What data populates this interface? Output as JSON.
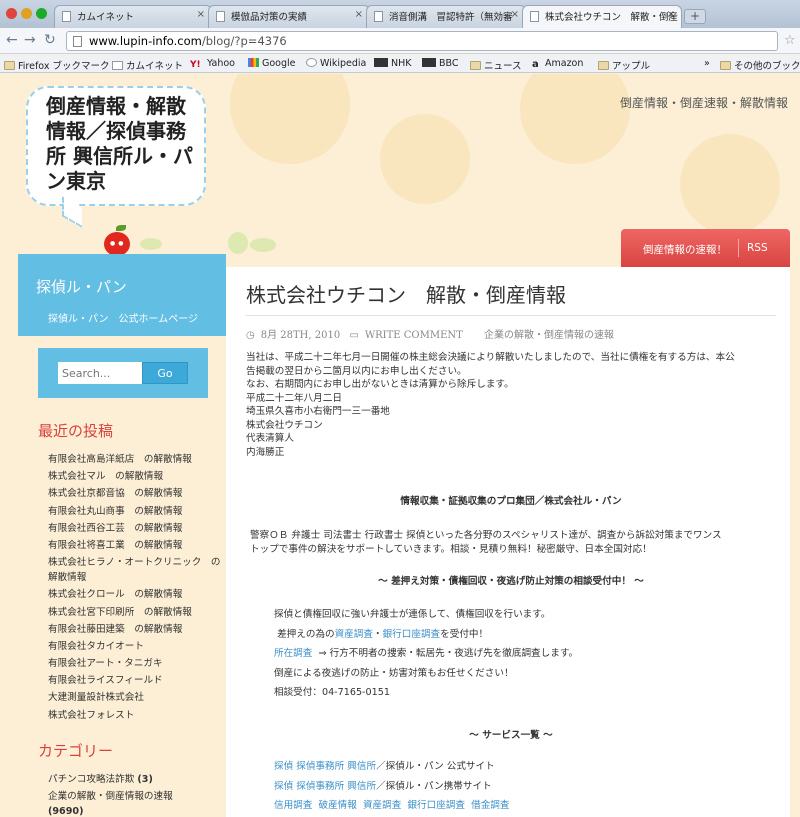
{
  "browser": {
    "tabs": [
      {
        "label": "カムイネット"
      },
      {
        "label": "模倣品対策の実績"
      },
      {
        "label": "消音側溝　冒認特許（無効審"
      },
      {
        "label": "株式会社ウチコン　解散・倒産"
      }
    ],
    "url_host": "www.lupin-info.com",
    "url_rest": "/blog/?p=4376",
    "bookmarks": [
      "Firefox ブックマーク",
      "カムイネット",
      "Yahoo",
      "Google",
      "Wikipedia",
      "NHK",
      "BBC",
      "ニュース",
      "Amazon",
      "アップル",
      "その他のブック"
    ]
  },
  "header": {
    "site_title": "倒産情報・解散情報／探偵事務所 興信所ル・パン東京",
    "tagline": "倒産情報・倒産速報・解散情報",
    "redbar_links": [
      "倒産情報の速報！",
      "RSS"
    ]
  },
  "sidebar": {
    "blue_title": "探偵ル・パン",
    "blue_sub": "探偵ル・パン　公式ホームページ",
    "search_placeholder": "Search...",
    "search_button": "Go",
    "recent_heading": "最近の投稿",
    "recent_posts": [
      "有限会社高島洋紙店　の解散情報",
      "株式会社マル　の解散情報",
      "株式会社京都音協　の解散情報",
      "有限会社丸山商事　の解散情報",
      "有限会社西谷工芸　の解散情報",
      "有限会社将喜工業　の解散情報",
      "株式会社ヒラノ・オートクリニック　の解散情報",
      "株式会社クロール　の解散情報",
      "株式会社宮下印刷所　の解散情報",
      "有限会社藤田建築　の解散情報",
      "有限会社タカイオート",
      "有限会社アート・タニガキ",
      "有限会社ライスフィールド",
      "大建測量設計株式会社",
      "株式会社フォレスト"
    ],
    "category_heading": "カテゴリー",
    "categories": [
      {
        "name": "パチンコ攻略法詐欺",
        "count": "(3)"
      },
      {
        "name": "企業の解散・倒産情報の速報",
        "count": "(9690)"
      }
    ]
  },
  "post": {
    "title": "株式会社ウチコン　解散・倒産情報",
    "date": "8月 28TH, 2010",
    "write_comment": "WRITE COMMENT",
    "category": "企業の解散・倒産情報の速報",
    "paragraph_lines": [
      "当社は、平成二十二年七月一日開催の株主総会決議により解散いたしましたので、当社に債権を有する方は、本公",
      "告掲載の翌日から二箇月以内にお申し出ください。",
      "なお、右期間内にお申し出がないときは清算から除斥します。",
      "平成二十二年八月二日",
      "埼玉県久喜市小右衛門一三一番地",
      "株式会社ウチコン",
      "代表清算人",
      "内海勝正"
    ],
    "ad_heading": "情報収集・証拠収集のプロ集団／株式会社ル・パン",
    "ad_lines": [
      "警察ＯＢ 弁護士 司法書士 行政書士 探偵といった各分野のスペシャリスト達が、調査から訴訟対策までワンス",
      "トップで事件の解決をサポートしていきます。相談・見積り無料！秘密厳守、日本全国対応！"
    ],
    "campaign_heading": "～ 差押え対策・債権回収・夜逃げ防止対策の相談受付中！ ～",
    "campaign_line1": "探偵と債権回収に強い弁護士が連係して、債権回収を行います。",
    "campaign_line2_pre": "差押えの為の",
    "campaign_link1": "資産調査",
    "campaign_mid": "・",
    "campaign_link2": "銀行口座調査",
    "campaign_line2_post": "を受付中！",
    "campaign_link3": "所在調査",
    "campaign_line3": "⇒ 行方不明者の捜索・転居先・夜逃げ先を徹底調査します。",
    "campaign_line4": "倒産による夜逃げの防止・妨害対策もお任せください！",
    "campaign_line5": "相談受付：04-7165-0151",
    "services_heading": "～ サービス一覧 ～",
    "services_line1_links": [
      "探偵",
      "探偵事務所",
      "興信所"
    ],
    "services_line1_post": "／探偵ル・パン 公式サイト",
    "services_line2_links": [
      "探偵",
      "探偵事務所",
      "興信所"
    ],
    "services_line2_post": "／探偵ル・パン携帯サイト",
    "services_line3_links": [
      "信用調査",
      "破産情報",
      "資産調査",
      "銀行口座調査",
      "借金調査"
    ]
  }
}
